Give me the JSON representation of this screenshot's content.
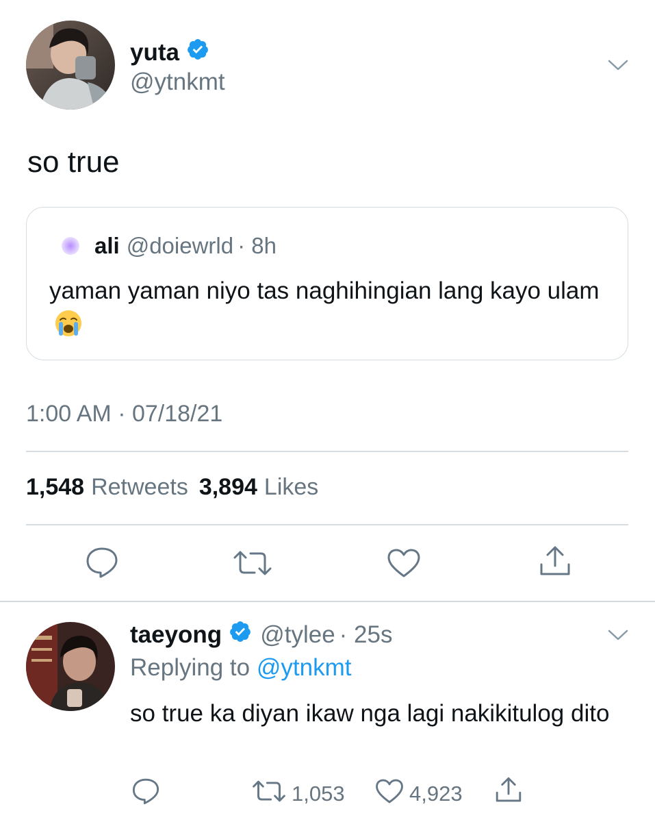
{
  "main_tweet": {
    "author_name": "yuta",
    "author_handle": "@ytnkmt",
    "verified": true,
    "text": "so true",
    "timestamp": "1:00 AM · 07/18/21",
    "retweets_count": "1,548",
    "retweets_label": "Retweets",
    "likes_count": "3,894",
    "likes_label": "Likes"
  },
  "quoted_tweet": {
    "author_name": "ali",
    "author_handle": "@doiewrld",
    "time": "· 8h",
    "text": "yaman yaman niyo tas naghihingian lang kayo ulam"
  },
  "reply": {
    "author_name": "taeyong",
    "author_handle": "@tylee",
    "time": "· 25s",
    "replying_prefix": "Replying to",
    "replying_handle": "@ytnkmt",
    "text": "so true ka diyan ikaw nga lagi nakikitulog dito",
    "retweet_count": "1,053",
    "like_count": "4,923"
  },
  "icons": [
    "verified-badge-icon",
    "chevron-down-icon",
    "reply-icon",
    "retweet-icon",
    "like-icon",
    "share-icon",
    "crying-face-emoji"
  ],
  "colors": {
    "accent": "#1d9bf0",
    "secondary_text": "#66757f",
    "border": "#d5dde3"
  }
}
